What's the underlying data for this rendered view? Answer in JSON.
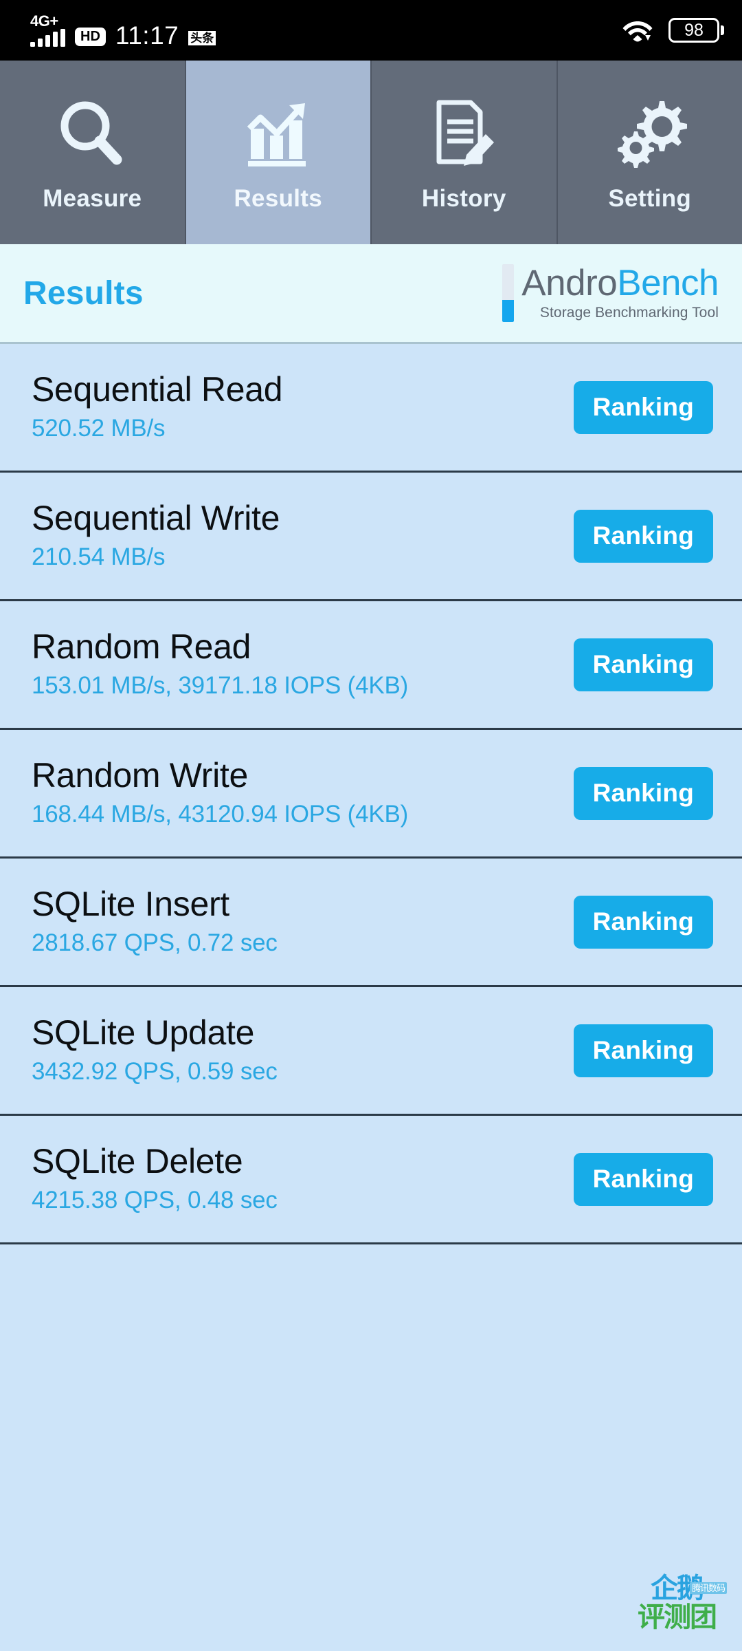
{
  "statusbar": {
    "network_label": "4G+",
    "signal_icon": "signal-bars-icon",
    "hd_badge": "HD",
    "time": "11:17",
    "app_badge": "头条",
    "wifi_icon": "wifi-icon",
    "battery_level": "98"
  },
  "tabs": [
    {
      "label": "Measure",
      "icon": "magnifier-icon",
      "active": false
    },
    {
      "label": "Results",
      "icon": "bar-chart-up-icon",
      "active": true
    },
    {
      "label": "History",
      "icon": "document-pencil-icon",
      "active": false
    },
    {
      "label": "Setting",
      "icon": "gears-icon",
      "active": false
    }
  ],
  "titlebar": {
    "page_title": "Results",
    "logo_primary": "Andro",
    "logo_secondary": "Bench",
    "logo_subtitle": "Storage Benchmarking Tool"
  },
  "results": [
    {
      "name": "Sequential Read",
      "value": "520.52 MB/s",
      "button": "Ranking"
    },
    {
      "name": "Sequential Write",
      "value": "210.54 MB/s",
      "button": "Ranking"
    },
    {
      "name": "Random Read",
      "value": "153.01 MB/s, 39171.18 IOPS (4KB)",
      "button": "Ranking"
    },
    {
      "name": "Random Write",
      "value": "168.44 MB/s, 43120.94 IOPS (4KB)",
      "button": "Ranking"
    },
    {
      "name": "SQLite Insert",
      "value": "2818.67 QPS, 0.72 sec",
      "button": "Ranking"
    },
    {
      "name": "SQLite Update",
      "value": "3432.92 QPS, 0.59 sec",
      "button": "Ranking"
    },
    {
      "name": "SQLite Delete",
      "value": "4215.38 QPS, 0.48 sec",
      "button": "Ranking"
    }
  ],
  "watermark": {
    "line1": "企鹅",
    "line2": "评测团",
    "tag": "腾讯数码"
  },
  "colors": {
    "accent_blue": "#17ace8",
    "value_blue": "#2aa7e2",
    "title_blue": "#22a8e8",
    "list_bg": "#cde4f9",
    "tab_inactive": "#636c7a",
    "tab_active": "#a6b8d2",
    "titlebar_bg": "#e6f9fb",
    "logo_gray": "#5f6873"
  }
}
